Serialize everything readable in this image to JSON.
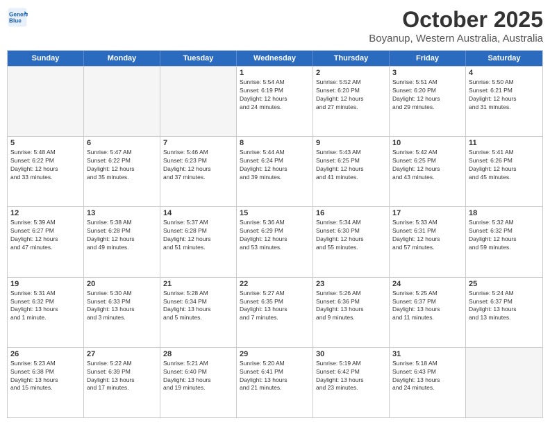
{
  "header": {
    "logo_line1": "General",
    "logo_line2": "Blue",
    "month": "October 2025",
    "location": "Boyanup, Western Australia, Australia"
  },
  "weekdays": [
    "Sunday",
    "Monday",
    "Tuesday",
    "Wednesday",
    "Thursday",
    "Friday",
    "Saturday"
  ],
  "rows": [
    [
      {
        "day": "",
        "info": ""
      },
      {
        "day": "",
        "info": ""
      },
      {
        "day": "",
        "info": ""
      },
      {
        "day": "1",
        "info": "Sunrise: 5:54 AM\nSunset: 6:19 PM\nDaylight: 12 hours\nand 24 minutes."
      },
      {
        "day": "2",
        "info": "Sunrise: 5:52 AM\nSunset: 6:20 PM\nDaylight: 12 hours\nand 27 minutes."
      },
      {
        "day": "3",
        "info": "Sunrise: 5:51 AM\nSunset: 6:20 PM\nDaylight: 12 hours\nand 29 minutes."
      },
      {
        "day": "4",
        "info": "Sunrise: 5:50 AM\nSunset: 6:21 PM\nDaylight: 12 hours\nand 31 minutes."
      }
    ],
    [
      {
        "day": "5",
        "info": "Sunrise: 5:48 AM\nSunset: 6:22 PM\nDaylight: 12 hours\nand 33 minutes."
      },
      {
        "day": "6",
        "info": "Sunrise: 5:47 AM\nSunset: 6:22 PM\nDaylight: 12 hours\nand 35 minutes."
      },
      {
        "day": "7",
        "info": "Sunrise: 5:46 AM\nSunset: 6:23 PM\nDaylight: 12 hours\nand 37 minutes."
      },
      {
        "day": "8",
        "info": "Sunrise: 5:44 AM\nSunset: 6:24 PM\nDaylight: 12 hours\nand 39 minutes."
      },
      {
        "day": "9",
        "info": "Sunrise: 5:43 AM\nSunset: 6:25 PM\nDaylight: 12 hours\nand 41 minutes."
      },
      {
        "day": "10",
        "info": "Sunrise: 5:42 AM\nSunset: 6:25 PM\nDaylight: 12 hours\nand 43 minutes."
      },
      {
        "day": "11",
        "info": "Sunrise: 5:41 AM\nSunset: 6:26 PM\nDaylight: 12 hours\nand 45 minutes."
      }
    ],
    [
      {
        "day": "12",
        "info": "Sunrise: 5:39 AM\nSunset: 6:27 PM\nDaylight: 12 hours\nand 47 minutes."
      },
      {
        "day": "13",
        "info": "Sunrise: 5:38 AM\nSunset: 6:28 PM\nDaylight: 12 hours\nand 49 minutes."
      },
      {
        "day": "14",
        "info": "Sunrise: 5:37 AM\nSunset: 6:28 PM\nDaylight: 12 hours\nand 51 minutes."
      },
      {
        "day": "15",
        "info": "Sunrise: 5:36 AM\nSunset: 6:29 PM\nDaylight: 12 hours\nand 53 minutes."
      },
      {
        "day": "16",
        "info": "Sunrise: 5:34 AM\nSunset: 6:30 PM\nDaylight: 12 hours\nand 55 minutes."
      },
      {
        "day": "17",
        "info": "Sunrise: 5:33 AM\nSunset: 6:31 PM\nDaylight: 12 hours\nand 57 minutes."
      },
      {
        "day": "18",
        "info": "Sunrise: 5:32 AM\nSunset: 6:32 PM\nDaylight: 12 hours\nand 59 minutes."
      }
    ],
    [
      {
        "day": "19",
        "info": "Sunrise: 5:31 AM\nSunset: 6:32 PM\nDaylight: 13 hours\nand 1 minute."
      },
      {
        "day": "20",
        "info": "Sunrise: 5:30 AM\nSunset: 6:33 PM\nDaylight: 13 hours\nand 3 minutes."
      },
      {
        "day": "21",
        "info": "Sunrise: 5:28 AM\nSunset: 6:34 PM\nDaylight: 13 hours\nand 5 minutes."
      },
      {
        "day": "22",
        "info": "Sunrise: 5:27 AM\nSunset: 6:35 PM\nDaylight: 13 hours\nand 7 minutes."
      },
      {
        "day": "23",
        "info": "Sunrise: 5:26 AM\nSunset: 6:36 PM\nDaylight: 13 hours\nand 9 minutes."
      },
      {
        "day": "24",
        "info": "Sunrise: 5:25 AM\nSunset: 6:37 PM\nDaylight: 13 hours\nand 11 minutes."
      },
      {
        "day": "25",
        "info": "Sunrise: 5:24 AM\nSunset: 6:37 PM\nDaylight: 13 hours\nand 13 minutes."
      }
    ],
    [
      {
        "day": "26",
        "info": "Sunrise: 5:23 AM\nSunset: 6:38 PM\nDaylight: 13 hours\nand 15 minutes."
      },
      {
        "day": "27",
        "info": "Sunrise: 5:22 AM\nSunset: 6:39 PM\nDaylight: 13 hours\nand 17 minutes."
      },
      {
        "day": "28",
        "info": "Sunrise: 5:21 AM\nSunset: 6:40 PM\nDaylight: 13 hours\nand 19 minutes."
      },
      {
        "day": "29",
        "info": "Sunrise: 5:20 AM\nSunset: 6:41 PM\nDaylight: 13 hours\nand 21 minutes."
      },
      {
        "day": "30",
        "info": "Sunrise: 5:19 AM\nSunset: 6:42 PM\nDaylight: 13 hours\nand 23 minutes."
      },
      {
        "day": "31",
        "info": "Sunrise: 5:18 AM\nSunset: 6:43 PM\nDaylight: 13 hours\nand 24 minutes."
      },
      {
        "day": "",
        "info": ""
      }
    ]
  ]
}
